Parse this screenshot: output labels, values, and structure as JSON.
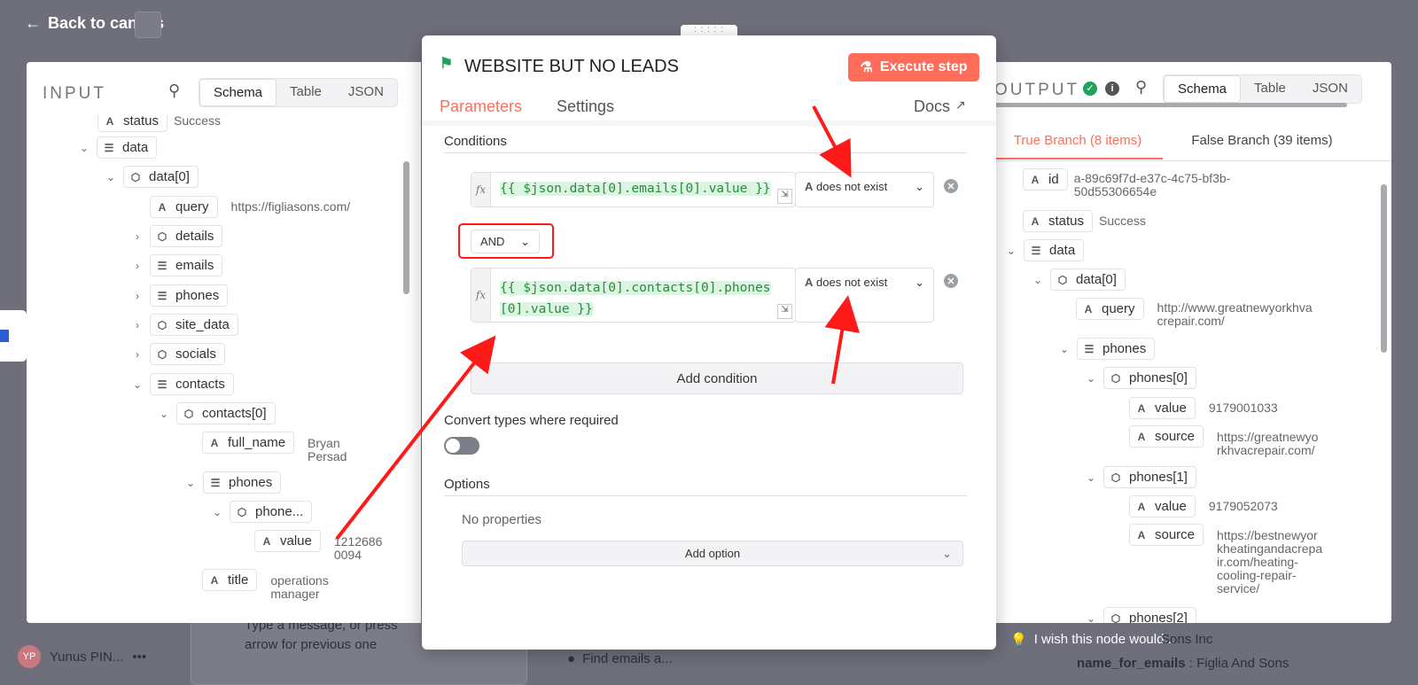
{
  "header": {
    "back_label": "Back to canvas"
  },
  "input_panel": {
    "title": "INPUT",
    "tabs": [
      "Schema",
      "Table",
      "JSON"
    ],
    "tree": {
      "status_key": "status",
      "status_val": "Success",
      "data_key": "data",
      "data0_key": "data[0]",
      "query_key": "query",
      "query_val": "https://figliasons.com/",
      "details_key": "details",
      "emails_key": "emails",
      "phones_key": "phones",
      "site_data_key": "site_data",
      "socials_key": "socials",
      "contacts_key": "contacts",
      "contacts0_key": "contacts[0]",
      "full_name_key": "full_name",
      "full_name_val_1": "Bryan",
      "full_name_val_2": "Persad",
      "cphones_key": "phones",
      "phone0_key": "phone...",
      "value_key": "value",
      "value_val_1": "1212686",
      "value_val_2": "0094",
      "title_key": "title",
      "title_val_1": "operations",
      "title_val_2": "manager"
    }
  },
  "node": {
    "title": "WEBSITE BUT NO LEADS",
    "execute_label": "Execute step",
    "tab_parameters": "Parameters",
    "tab_settings": "Settings",
    "docs_label": "Docs",
    "conditions_label": "Conditions",
    "condition1_expr": "{{ $json.data[0].emails[0].value }}",
    "condition1_op": "does not exist",
    "combinator": "AND",
    "condition2_expr_1": "{{ $json.data[0].contacts[0].phones",
    "condition2_expr_2": "[0].value }}",
    "condition2_op": "does not exist",
    "add_condition": "Add condition",
    "convert_types": "Convert types where required",
    "options_label": "Options",
    "no_properties": "No properties",
    "add_option": "Add option",
    "fx": "fx"
  },
  "output_panel": {
    "title": "OUTPUT",
    "tabs": [
      "Schema",
      "Table",
      "JSON"
    ],
    "branch_true": "True Branch (8 items)",
    "branch_false": "False Branch (39 items)",
    "tree": {
      "id_key": "id",
      "id_val_1": "a-89c69f7d-e37c-4c75-bf3b-",
      "id_val_2": "50d55306654e",
      "status_key": "status",
      "status_val": "Success",
      "data_key": "data",
      "data0_key": "data[0]",
      "query_key": "query",
      "query_val_1": "http://www.greatnewyorkhva",
      "query_val_2": "crepair.com/",
      "phones_key": "phones",
      "phones0_key": "phones[0]",
      "p0_value_key": "value",
      "p0_value_val": "9179001033",
      "p0_source_key": "source",
      "p0_source_val_1": "https://greatnewyo",
      "p0_source_val_2": "rkhvacrepair.com/",
      "phones1_key": "phones[1]",
      "p1_value_key": "value",
      "p1_value_val": "9179052073",
      "p1_source_key": "source",
      "p1_source_val_1": "https://bestnewyor",
      "p1_source_val_2": "kheatingandacrepa",
      "p1_source_val_3": "ir.com/heating-",
      "p1_source_val_4": "cooling-repair-",
      "p1_source_val_5": "service/",
      "phones2_key": "phones[2]"
    }
  },
  "background": {
    "user_name": "Yunus PIN...",
    "user_initials": "YP",
    "chat_placeholder_1": "Type a message, or press",
    "chat_placeholder_2": "arrow for previous one",
    "find_emails": "Find emails a...",
    "wish_text": "I wish this node would...",
    "sons_inc": "Sons Inc",
    "name_for_emails_key": "name_for_emails",
    "name_for_emails_val": "Figlia And Sons"
  },
  "colors": {
    "accent": "#ff6d5a",
    "arrow": "#ff1a1a",
    "code_green": "#2b8a3e"
  }
}
